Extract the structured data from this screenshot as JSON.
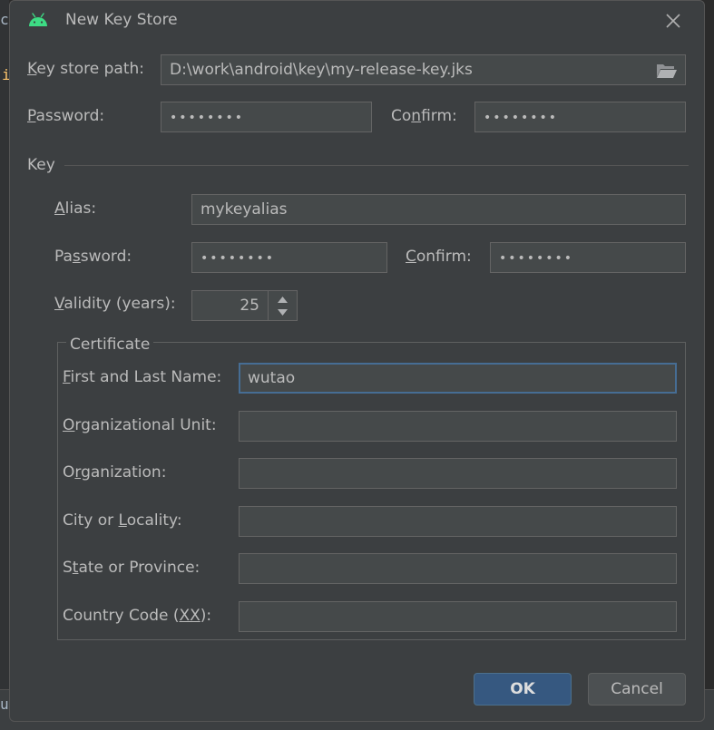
{
  "dialog": {
    "title": "New Key Store",
    "close_label": "×"
  },
  "keystore": {
    "path_label_mnemonic": "K",
    "path_label_rest": "ey store path:",
    "path_value": "D:\\work\\android\\key\\my-release-key.jks",
    "password_label_mnemonic": "P",
    "password_label_rest": "assword:",
    "password_value": "••••••••",
    "confirm_label_pre": "Co",
    "confirm_label_mnemonic": "n",
    "confirm_label_rest": "firm:",
    "confirm_value": "••••••••"
  },
  "key": {
    "section_title": "Key",
    "alias_label_mnemonic": "A",
    "alias_label_rest": "lias:",
    "alias_value": "mykeyalias",
    "password_label_pre": "Pa",
    "password_label_mnemonic": "s",
    "password_label_rest": "sword:",
    "password_value": "••••••••",
    "confirm_label_mnemonic": "C",
    "confirm_label_rest": "onfirm:",
    "confirm_value": "••••••••",
    "validity_label_mnemonic": "V",
    "validity_label_rest": "alidity (years):",
    "validity_value": "25"
  },
  "certificate": {
    "legend": "Certificate",
    "fields": [
      {
        "pre": "",
        "mnemonic": "F",
        "rest": "irst and Last Name:",
        "value": "wutao"
      },
      {
        "pre": "",
        "mnemonic": "O",
        "rest": "rganizational Unit:",
        "value": ""
      },
      {
        "pre": "O",
        "mnemonic": "r",
        "rest": "ganization:",
        "value": ""
      },
      {
        "pre": "City or ",
        "mnemonic": "L",
        "rest": "ocality:",
        "value": ""
      },
      {
        "pre": "S",
        "mnemonic": "t",
        "rest": "ate or Province:",
        "value": ""
      },
      {
        "pre": "Country Code (",
        "mnemonic": "XX",
        "rest": "):",
        "value": ""
      }
    ]
  },
  "buttons": {
    "ok": "OK",
    "cancel": "Cancel"
  },
  "background": {
    "chars": [
      "c",
      "i",
      "u"
    ]
  },
  "colors": {
    "dialog_bg": "#3c3f41",
    "field_bg": "#45494a",
    "focus_border": "#466d94",
    "ok_bg": "#365880",
    "android_green": "#3ddc84"
  }
}
